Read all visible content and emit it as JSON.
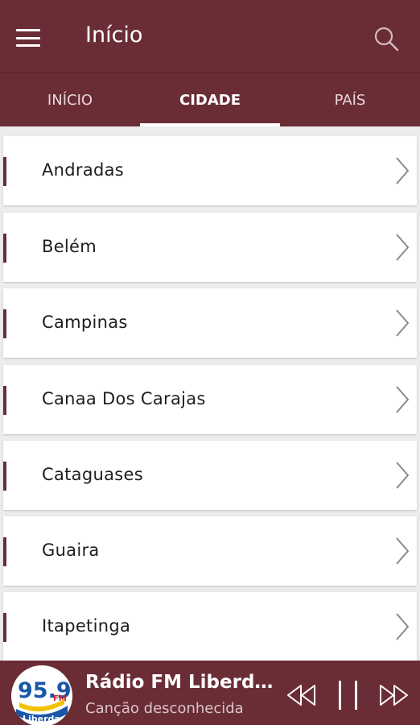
{
  "appbar": {
    "title": "Início",
    "menu_icon": "hamburger-menu-icon",
    "search_icon": "search-icon"
  },
  "tabs": [
    {
      "label": "INÍCIO",
      "active": false
    },
    {
      "label": "CIDADE",
      "active": true
    },
    {
      "label": "PAÍS",
      "active": false
    }
  ],
  "cities": [
    {
      "name": "Andradas"
    },
    {
      "name": "Belém"
    },
    {
      "name": "Campinas"
    },
    {
      "name": "Canaa Dos Carajas"
    },
    {
      "name": "Cataguases"
    },
    {
      "name": "Guaira"
    },
    {
      "name": "Itapetinga"
    }
  ],
  "player": {
    "station": "Rádio FM Liberdade",
    "song": "Canção desconhecida",
    "logo": {
      "number": "95.9",
      "band": "FM",
      "brand": "Liberdade"
    },
    "controls": [
      "rewind-icon",
      "pause-icon",
      "fast-forward-icon"
    ]
  },
  "colors": {
    "primary": "#6b2d35",
    "background": "#ececec",
    "card": "#ffffff",
    "text": "#1d1d1d"
  }
}
